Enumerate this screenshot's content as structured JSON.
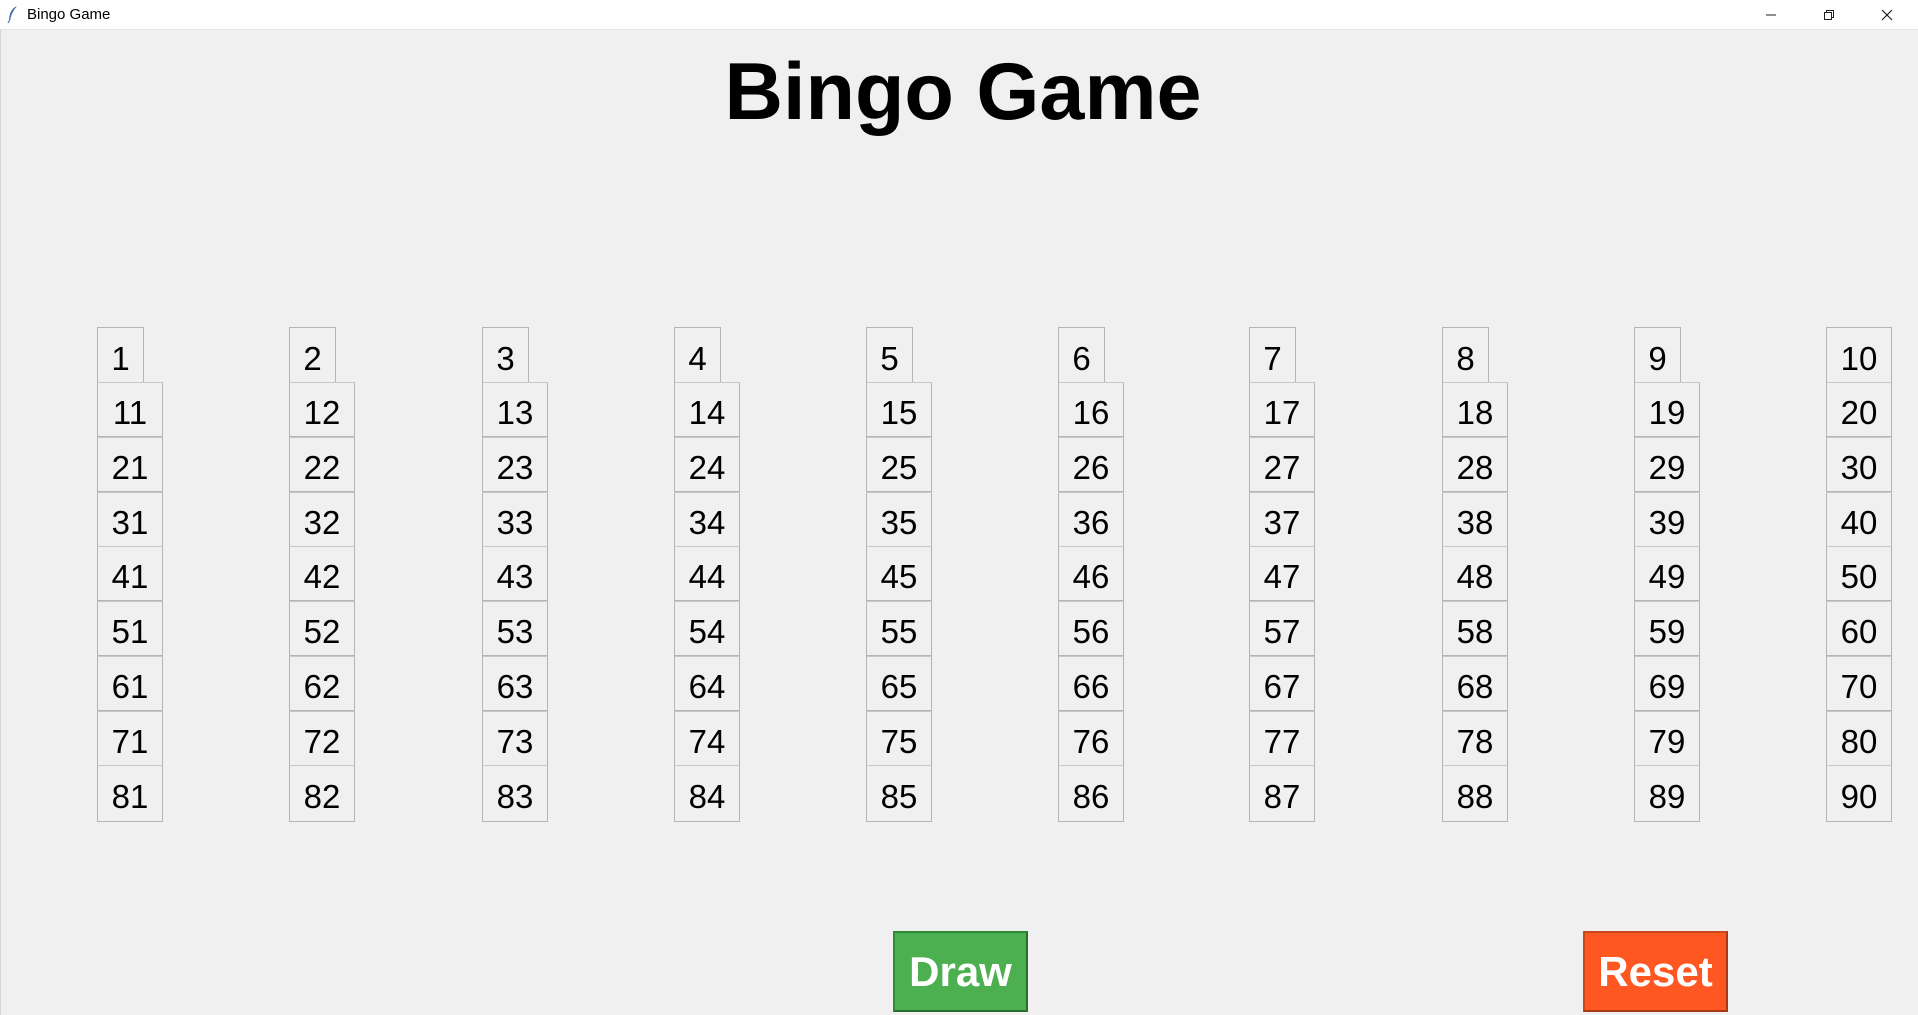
{
  "window": {
    "title": "Bingo Game",
    "icons": {
      "app": "feather-icon",
      "minimize": "minimize-icon",
      "maximize": "restore-icon",
      "close": "close-icon"
    }
  },
  "heading": "Bingo Game",
  "board": {
    "rows": [
      [
        "1",
        "2",
        "3",
        "4",
        "5",
        "6",
        "7",
        "8",
        "9",
        "10"
      ],
      [
        "11",
        "12",
        "13",
        "14",
        "15",
        "16",
        "17",
        "18",
        "19",
        "20"
      ],
      [
        "21",
        "22",
        "23",
        "24",
        "25",
        "26",
        "27",
        "28",
        "29",
        "30"
      ],
      [
        "31",
        "32",
        "33",
        "34",
        "35",
        "36",
        "37",
        "38",
        "39",
        "40"
      ],
      [
        "41",
        "42",
        "43",
        "44",
        "45",
        "46",
        "47",
        "48",
        "49",
        "50"
      ],
      [
        "51",
        "52",
        "53",
        "54",
        "55",
        "56",
        "57",
        "58",
        "59",
        "60"
      ],
      [
        "61",
        "62",
        "63",
        "64",
        "65",
        "66",
        "67",
        "68",
        "69",
        "70"
      ],
      [
        "71",
        "72",
        "73",
        "74",
        "75",
        "76",
        "77",
        "78",
        "79",
        "80"
      ],
      [
        "81",
        "82",
        "83",
        "84",
        "85",
        "86",
        "87",
        "88",
        "89",
        "90"
      ]
    ]
  },
  "buttons": {
    "draw": {
      "label": "Draw",
      "color": "#4caf50"
    },
    "reset": {
      "label": "Reset",
      "color": "#ff5722"
    }
  }
}
